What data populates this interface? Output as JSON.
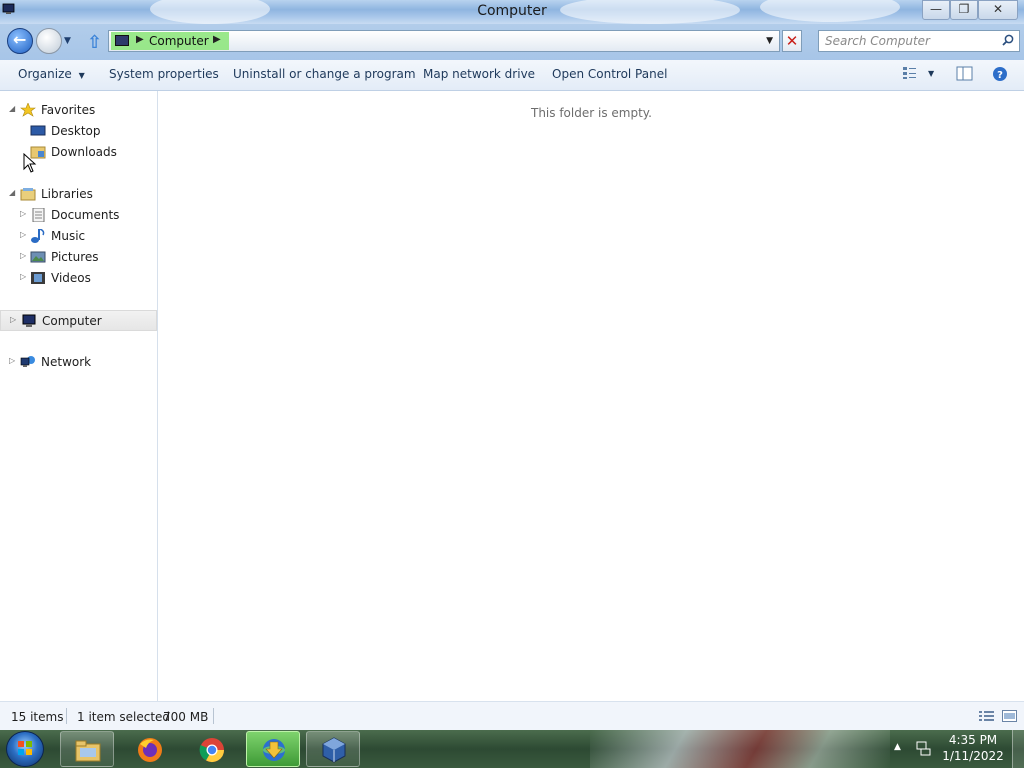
{
  "window": {
    "title": "Computer",
    "minimize_icon": "minimize-icon",
    "restore_icon": "restore-icon",
    "close_icon": "close-icon"
  },
  "nav": {
    "address_segments": [
      "Computer"
    ],
    "search_placeholder": "Search Computer"
  },
  "commands": {
    "organize": "Organize",
    "system_properties": "System properties",
    "uninstall": "Uninstall or change a program",
    "map_network_drive": "Map network drive",
    "open_control_panel": "Open Control Panel"
  },
  "sidebar": {
    "favorites": {
      "label": "Favorites",
      "items": [
        {
          "label": "Desktop",
          "icon": "desktop-icon"
        },
        {
          "label": "Downloads",
          "icon": "downloads-folder-icon"
        }
      ]
    },
    "libraries": {
      "label": "Libraries",
      "items": [
        {
          "label": "Documents",
          "icon": "documents-icon"
        },
        {
          "label": "Music",
          "icon": "music-icon"
        },
        {
          "label": "Pictures",
          "icon": "pictures-icon"
        },
        {
          "label": "Videos",
          "icon": "videos-icon"
        }
      ]
    },
    "computer": {
      "label": "Computer",
      "selected": true
    },
    "network": {
      "label": "Network"
    }
  },
  "content": {
    "empty_message": "This folder is empty."
  },
  "status": {
    "item_count": "15 items",
    "selection": "1 item selected",
    "size": "700 MB"
  },
  "taskbar": {
    "apps": [
      {
        "name": "Windows Explorer",
        "icon": "explorer-icon",
        "active": false
      },
      {
        "name": "Firefox",
        "icon": "firefox-icon",
        "active": false
      },
      {
        "name": "Chrome",
        "icon": "chrome-icon",
        "active": false
      },
      {
        "name": "Internet Download Manager",
        "icon": "idm-icon",
        "active": true
      },
      {
        "name": "VirtualBox",
        "icon": "virtualbox-icon",
        "active": false
      }
    ],
    "clock_time": "4:35 PM",
    "clock_date": "1/11/2022"
  },
  "colors": {
    "titlebar": "#a9c7ea",
    "address_highlight": "#8fe57e",
    "command_text": "#1e395b",
    "taskbar": "#2d4a33"
  }
}
